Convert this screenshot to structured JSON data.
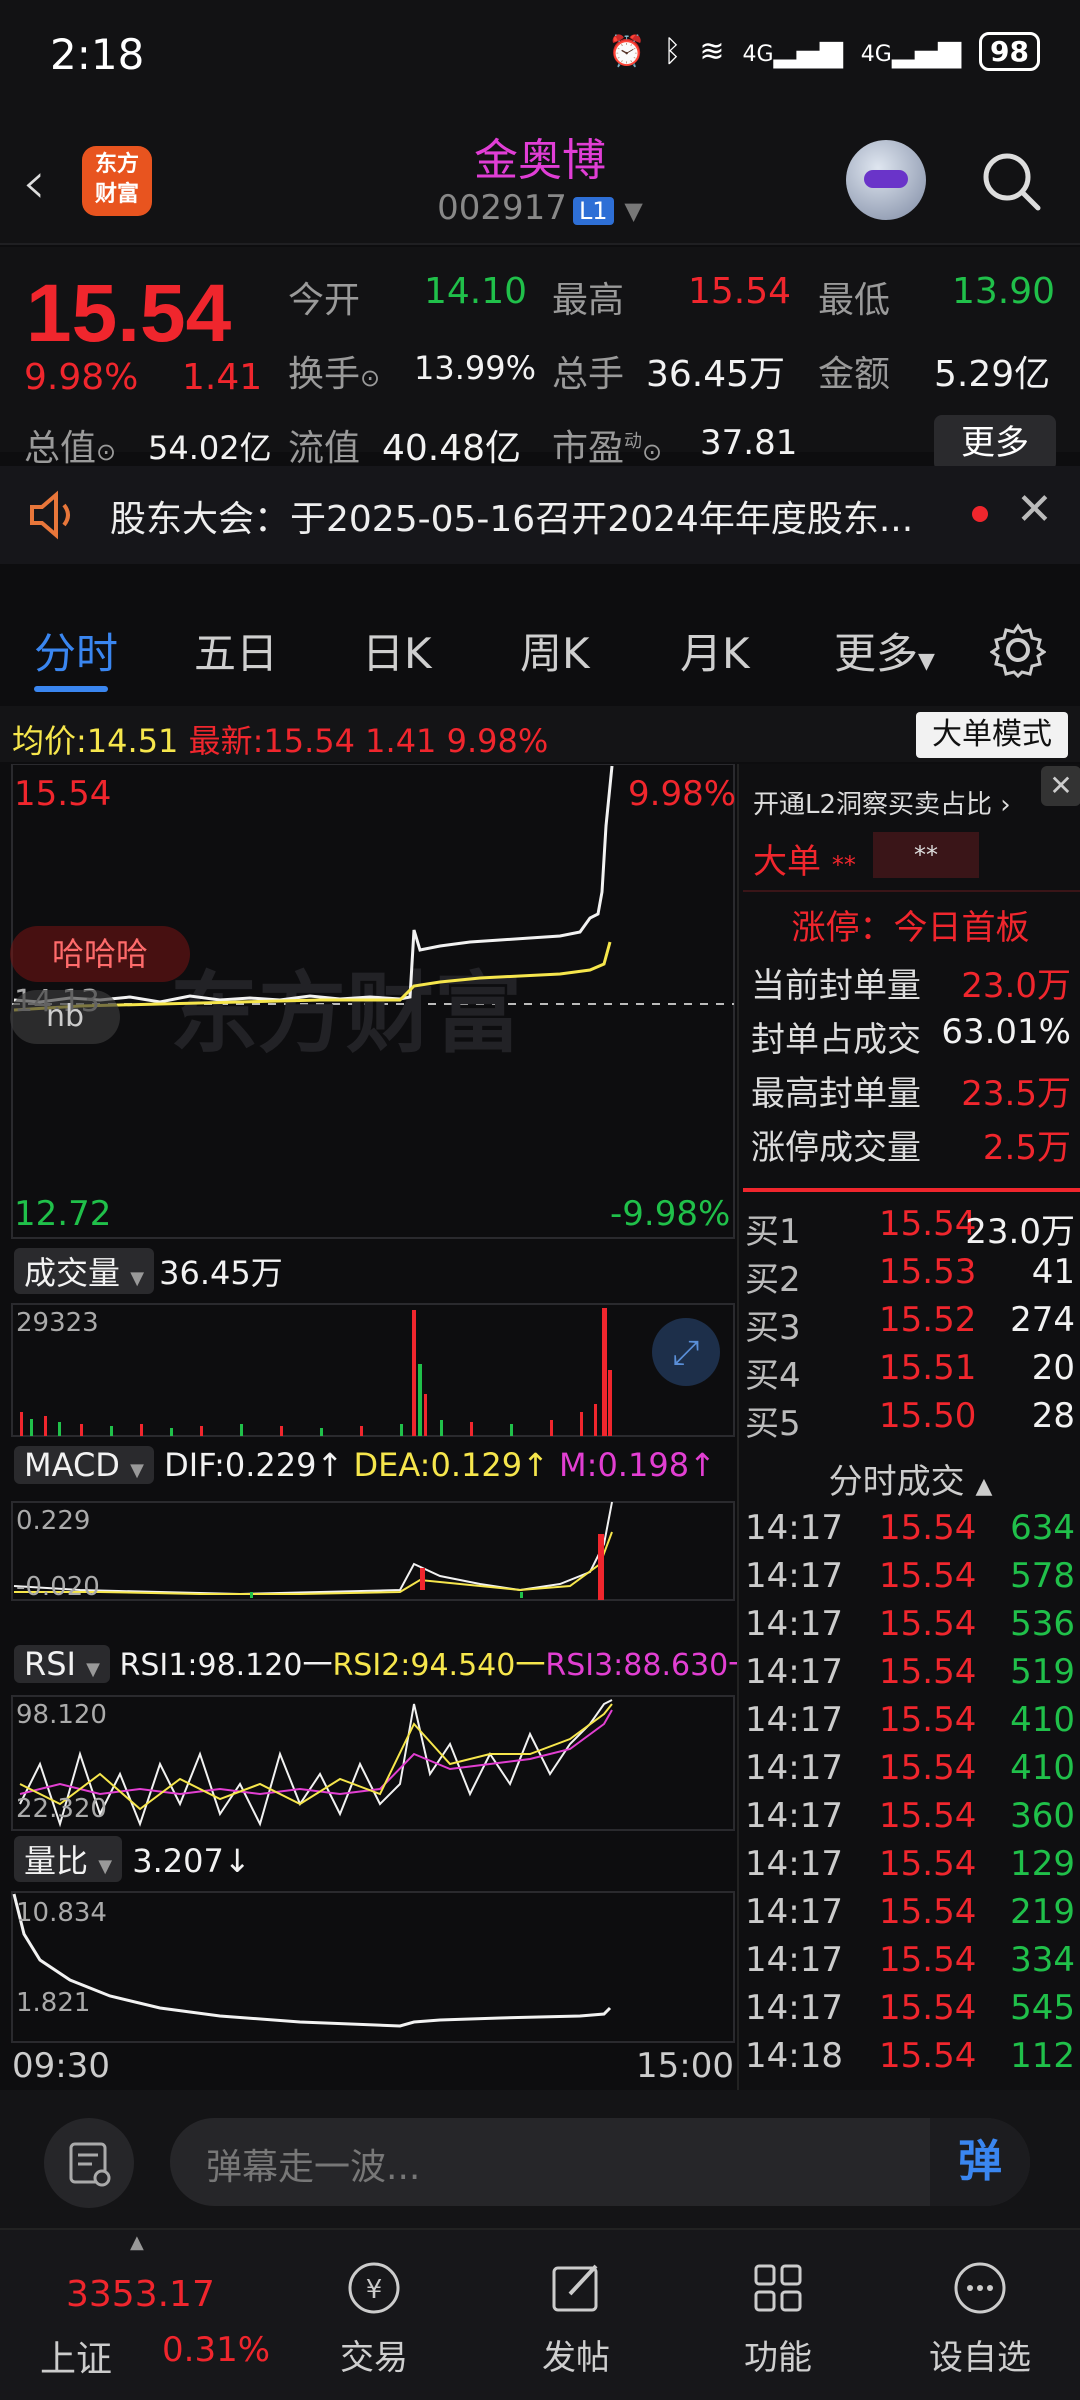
{
  "status_bar": {
    "time": "2:18",
    "network": "4G",
    "network2": "4G",
    "battery": "98"
  },
  "header": {
    "stock_name": "金奥博",
    "stock_code": "002917",
    "level_badge": "L1",
    "logo_text_top": "东方",
    "logo_text_bottom": "财富"
  },
  "quote": {
    "price": "15.54",
    "change_pct": "9.98%",
    "change_amt": "1.41",
    "open_label": "今开",
    "open": "14.10",
    "high_label": "最高",
    "high": "15.54",
    "low_label": "最低",
    "low": "13.90",
    "turnover_label": "换手",
    "turnover": "13.99%",
    "volume_label": "总手",
    "volume": "36.45万",
    "amount_label": "金额",
    "amount": "5.29亿",
    "mcap_label": "总值",
    "mcap": "54.02亿",
    "float_label": "流值",
    "float": "40.48亿",
    "pe_label": "市盈",
    "pe_sup": "动",
    "pe": "37.81",
    "more_button": "更多"
  },
  "notice": {
    "text": "股东大会：于2025-05-16召开2024年年度股东..."
  },
  "tabs": [
    "分时",
    "五日",
    "日K",
    "周K",
    "月K",
    "更多"
  ],
  "avg_row": {
    "avg_label": "均价:",
    "avg": "14.51",
    "latest_label": "最新:",
    "latest": "15.54",
    "chg": "1.41",
    "pct": "9.98%",
    "big_mode": "大单模式"
  },
  "chart": {
    "top_price": "15.54",
    "top_pct": "9.98%",
    "bottom_price": "12.72",
    "bottom_pct": "-9.98%",
    "prev_close": "14.13",
    "watermark": "东方财富",
    "bubble1": "哈哈哈",
    "bubble2": "nb",
    "volume_label": "成交量",
    "volume_value": "36.45万",
    "volume_max": "29323",
    "macd_label": "MACD",
    "dif": "DIF:0.229↑",
    "dea": "DEA:0.129↑",
    "m": "M:0.198↑",
    "macd_top": "0.229",
    "macd_low": "-0.020",
    "rsi_label": "RSI",
    "rsi1": "RSI1:98.120一",
    "rsi2": "RSI2:94.540一",
    "rsi3": "RSI3:88.630一",
    "rsi_top": "98.120",
    "rsi_low": "22.320",
    "lb_label": "量比",
    "lb_value": "3.207↓",
    "lb_top": "10.834",
    "lb_low": "1.821",
    "time_start": "09:30",
    "time_end": "15:00"
  },
  "right_panel": {
    "l2_title": "开通L2洞察买卖占比",
    "big_order": "大单",
    "stars1": "**",
    "stars2": "**",
    "limit_title": "涨停：今日首板",
    "stats": [
      {
        "label": "当前封单量",
        "value": "23.0万"
      },
      {
        "label": "封单占成交",
        "value": "63.01%"
      },
      {
        "label": "最高封单量",
        "value": "23.5万"
      },
      {
        "label": "涨停成交量",
        "value": "2.5万"
      }
    ],
    "bids": [
      {
        "label": "买1",
        "price": "15.54",
        "vol": "23.0万"
      },
      {
        "label": "买2",
        "price": "15.53",
        "vol": "41"
      },
      {
        "label": "买3",
        "price": "15.52",
        "vol": "274"
      },
      {
        "label": "买4",
        "price": "15.51",
        "vol": "20"
      },
      {
        "label": "买5",
        "price": "15.50",
        "vol": "28"
      }
    ],
    "ticks_title": "分时成交",
    "ticks": [
      {
        "time": "14:17",
        "price": "15.54",
        "vol": "634"
      },
      {
        "time": "14:17",
        "price": "15.54",
        "vol": "578"
      },
      {
        "time": "14:17",
        "price": "15.54",
        "vol": "536"
      },
      {
        "time": "14:17",
        "price": "15.54",
        "vol": "519"
      },
      {
        "time": "14:17",
        "price": "15.54",
        "vol": "410"
      },
      {
        "time": "14:17",
        "price": "15.54",
        "vol": "410"
      },
      {
        "time": "14:17",
        "price": "15.54",
        "vol": "360"
      },
      {
        "time": "14:17",
        "price": "15.54",
        "vol": "129"
      },
      {
        "time": "14:17",
        "price": "15.54",
        "vol": "219"
      },
      {
        "time": "14:17",
        "price": "15.54",
        "vol": "334"
      },
      {
        "time": "14:17",
        "price": "15.54",
        "vol": "545"
      },
      {
        "time": "14:18",
        "price": "15.54",
        "vol": "112"
      }
    ]
  },
  "danmu": {
    "placeholder": "弹幕走一波...",
    "button": "弹"
  },
  "bottom_nav": {
    "index_value": "3353.17",
    "index_name": "上证",
    "index_pct": "0.31%",
    "items": [
      "交易",
      "发帖",
      "功能",
      "设自选"
    ]
  }
}
